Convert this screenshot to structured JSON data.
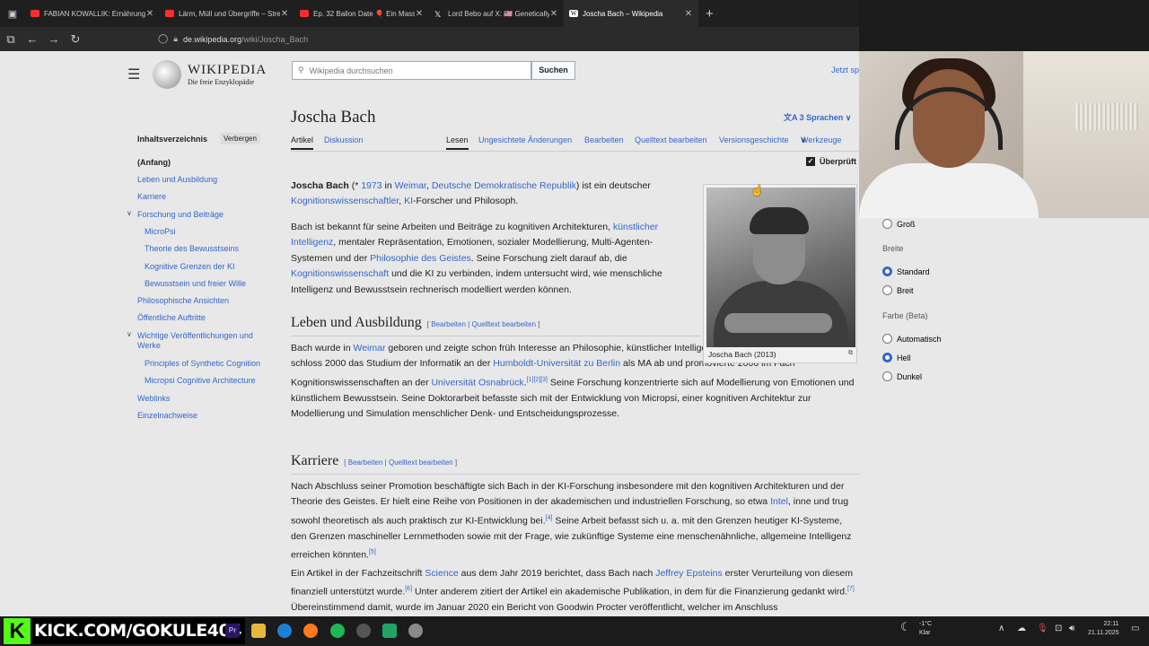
{
  "browser": {
    "tabs": [
      {
        "title": "FABIAN KOWALLIK: Ernährungs",
        "favicon_color": "#ff2d2d"
      },
      {
        "title": "Lärm, Müll und Übergriffe – Stre",
        "favicon_color": "#ff2d2d"
      },
      {
        "title": "Ep. 32 Ballon Date 🎈 Ein Massi",
        "favicon_color": "#ff2d2d"
      },
      {
        "title": "Lord Bebo auf X: 🇺🇸 Genetically",
        "favicon_color": "#ffffff"
      },
      {
        "title": "Joscha Bach – Wikipedia",
        "favicon_color": "#ffffff",
        "active": true
      }
    ],
    "new_tab": "+",
    "url_host": "de.wikipedia.org",
    "url_path": "/wiki/Joscha_Bach"
  },
  "wiki": {
    "hamburger": "☰",
    "logo_title": "WIKIPEDIA",
    "logo_subtitle": "Die freie Enzyklopädie",
    "search_placeholder": "Wikipedia durchsuchen",
    "search_button": "Suchen",
    "jetzt": "Jetzt sp",
    "toc_title": "Inhaltsverzeichnis",
    "toc_hide": "Verbergen",
    "toc": [
      "(Anfang)",
      "Leben und Ausbildung",
      "Karriere",
      "Forschung und Beiträge",
      "MicroPsi",
      "Theorie des Bewusstseins",
      "Kognitive Grenzen der KI",
      "Bewusstsein und freier Wille",
      "Philosophische Ansichten",
      "Öffentliche Auftritte",
      "Wichtige Veröffentlichungen und",
      "Werke",
      "Principles of Synthetic Cognition",
      "Micropsi Cognitive Architecture",
      "Weblinks",
      "Einzelnachweise"
    ],
    "title": "Joscha Bach",
    "languages": "3 Sprachen",
    "tabs_left": [
      "Artikel",
      "Diskussion"
    ],
    "tabs_right": [
      "Lesen",
      "Ungesichtete Änderungen",
      "Bearbeiten",
      "Quelltext bearbeiten",
      "Versionsgeschichte",
      "Werkzeuge"
    ],
    "checked_label": "Überprüft",
    "section_edit": "Bearbeiten",
    "section_source": "Quelltext bearbeiten",
    "sections": [
      "Leben und Ausbildung",
      "Karriere"
    ],
    "image_caption": "Joscha Bach (2013)"
  },
  "appearance": {
    "gross": "Groß",
    "breite": "Breite",
    "standard": "Standard",
    "breit": "Breit",
    "farbe": "Farbe (Beta)",
    "automatisch": "Automatisch",
    "hell": "Hell",
    "dunkel": "Dunkel"
  },
  "overlay": {
    "kick_label": "KICK.COM/GOKULE404",
    "weather_temp": "-1°C",
    "weather_desc": "Klar",
    "clock_time": "22:11",
    "clock_date": "21.11.2025"
  }
}
